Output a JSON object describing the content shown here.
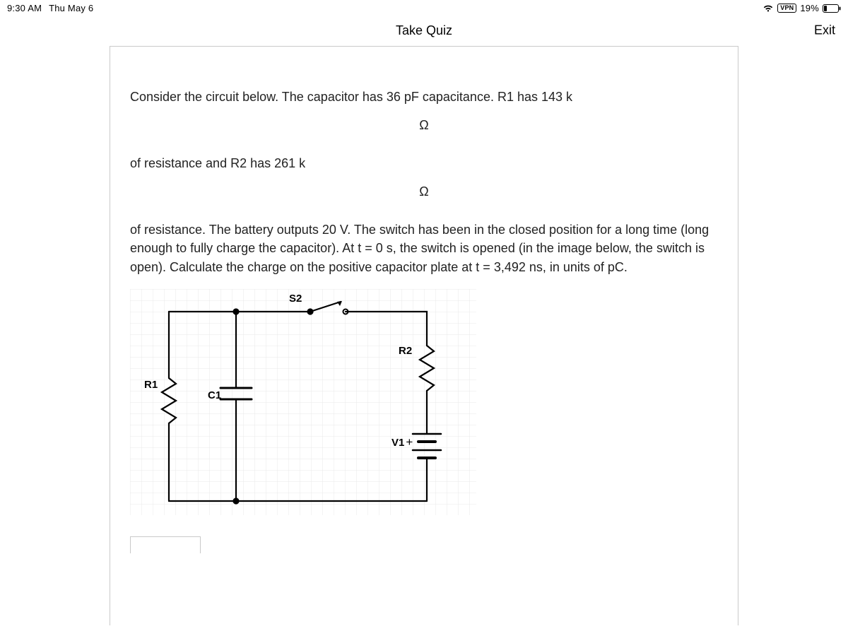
{
  "status": {
    "time": "9:30 AM",
    "date": "Thu May 6",
    "vpn": "VPN",
    "battery_pct": "19%"
  },
  "header": {
    "title": "Take Quiz",
    "exit": "Exit"
  },
  "question": {
    "line1": "Consider the circuit below.  The capacitor has 36 pF capacitance.  R1 has 143 k",
    "omega1": "Ω",
    "line2": "of resistance and R2 has 261 k",
    "omega2": "Ω",
    "line3": " of resistance.  The battery outputs 20 V.  The switch has been in the closed position for a long time (long enough to fully charge the capacitor).  At t = 0 s, the switch is opened (in the image below, the switch is open).  Calculate the charge on the positive capacitor plate at t = 3,492 ns, in units of pC."
  },
  "circuit": {
    "label_S2": "S2",
    "label_R1": "R1",
    "label_C1": "C1",
    "label_R2": "R2",
    "label_V1": "V1"
  }
}
